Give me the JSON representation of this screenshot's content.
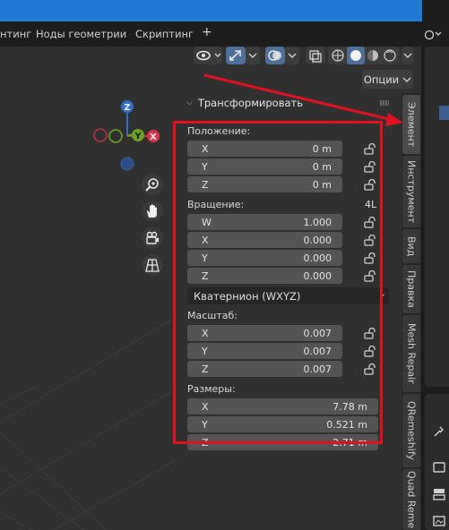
{
  "workspace_tabs": [
    "нтинг",
    "Ноды геометрии",
    "Скриптинг",
    "+"
  ],
  "header": {
    "options_label": "Опции",
    "icons": [
      "eye-icon",
      "gizmo-icon",
      "overlay-icon",
      "xray-icon",
      "shading-wireframe-icon",
      "shading-solid-icon",
      "shading-material-icon",
      "shading-rendered-icon"
    ]
  },
  "navigation": {
    "gizmo_axes": [
      "Z",
      "Y",
      "X"
    ],
    "tools": [
      "zoom-icon",
      "hand-icon",
      "camera-icon",
      "grid-view-icon"
    ]
  },
  "panel": {
    "title": "Трансформировать",
    "location": {
      "label": "Положение:",
      "rows": [
        {
          "axis": "X",
          "value": "0 m"
        },
        {
          "axis": "Y",
          "value": "0 m"
        },
        {
          "axis": "Z",
          "value": "0 m"
        }
      ]
    },
    "rotation": {
      "label": "Вращение:",
      "mode_badge": "4L",
      "rows": [
        {
          "axis": "W",
          "value": "1.000"
        },
        {
          "axis": "X",
          "value": "0.000"
        },
        {
          "axis": "Y",
          "value": "0.000"
        },
        {
          "axis": "Z",
          "value": "0.000"
        }
      ],
      "mode": "Кватернион (WXYZ)"
    },
    "scale": {
      "label": "Масштаб:",
      "rows": [
        {
          "axis": "X",
          "value": "0.007"
        },
        {
          "axis": "Y",
          "value": "0.007"
        },
        {
          "axis": "Z",
          "value": "0.007"
        }
      ]
    },
    "dimensions": {
      "label": "Размеры:",
      "rows": [
        {
          "axis": "X",
          "value": "7.78 m"
        },
        {
          "axis": "Y",
          "value": "0.521 m"
        },
        {
          "axis": "Z",
          "value": "2.71 m"
        }
      ]
    }
  },
  "side_tabs": [
    "Элемент",
    "Инструмент",
    "Вид",
    "Правка",
    "Mesh Repair",
    "QRemeshify",
    "Quad Reme"
  ],
  "colors": {
    "accent": "#1f78d1",
    "annotation": "#e0121f",
    "axis_x": "#d9344a",
    "axis_y": "#6da21f",
    "axis_z": "#2f6fc8"
  }
}
